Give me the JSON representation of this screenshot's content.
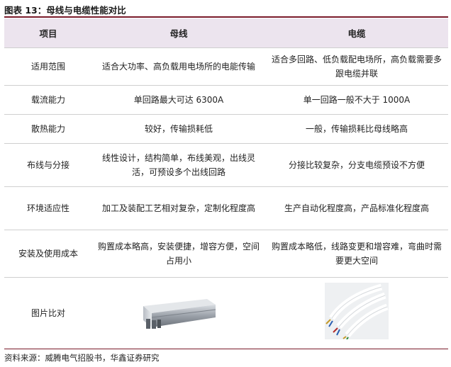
{
  "title": "图表 13：母线与电缆性能对比",
  "header": [
    "项目",
    "母线",
    "电缆"
  ],
  "rows": [
    [
      "适用范围",
      "适合大功率、高负载用电场所的电能传输",
      "适合多回路、低负载配电场所，高负载需要多跟电缆并联"
    ],
    [
      "载流能力",
      "单回路最大可达 6300A",
      "单一回路一般不大于 1000A"
    ],
    [
      "散热能力",
      "较好，传输损耗低",
      "一般，传输损耗比母线略高"
    ],
    [
      "布线与分接",
      "线性设计，结构简单，布线美观，出线灵活，可预设多个出线回路",
      "分接比较复杂，分支电缆预设不方便"
    ],
    [
      "环境适应性",
      "加工及装配工艺相对复杂，定制化程度高",
      "生产自动化程度高，产品标准化程度高"
    ],
    [
      "安装及使用成本",
      "购置成本略高，安装便捷，增容方便，空间占用小",
      "购置成本略低，线路变更和增容难，弯曲时需要更大空间"
    ]
  ],
  "image_row": {
    "label": "图片比对",
    "busbar_image": "busbar-photo",
    "cable_image": "cable-photo"
  },
  "source": "资料来源：威腾电气招股书，华鑫证券研究",
  "colors": {
    "rule": "#7a1b2a",
    "header_bg": "#ece4ee"
  }
}
